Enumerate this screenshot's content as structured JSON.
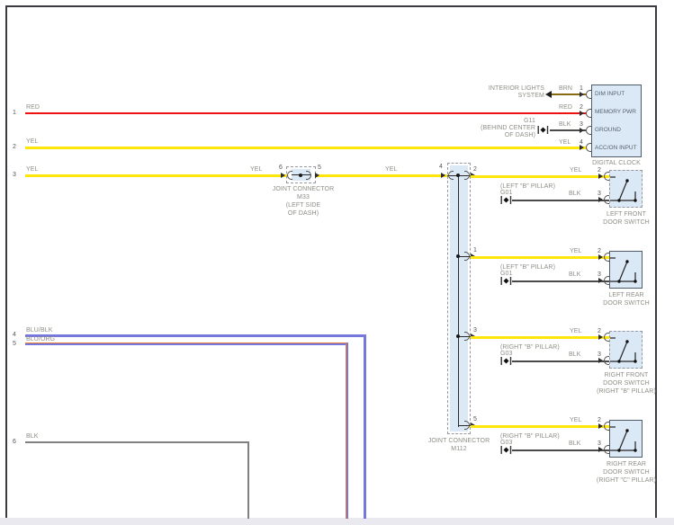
{
  "left_wires": [
    {
      "num": "1",
      "label": "RED"
    },
    {
      "num": "2",
      "label": "YEL"
    },
    {
      "num": "3",
      "label": "YEL"
    },
    {
      "num": "4",
      "label": "BLU/BLK"
    },
    {
      "num": "5",
      "label": "BLU/ORG"
    },
    {
      "num": "6",
      "label": "BLK"
    }
  ],
  "interior_lights": {
    "line1": "INTERIOR LIGHTS",
    "line2": "SYSTEM"
  },
  "clock": {
    "title": "DIGITAL CLOCK",
    "pins": [
      {
        "num": "1",
        "wire": "BRN",
        "label": "DIM INPUT"
      },
      {
        "num": "2",
        "wire": "RED",
        "label": "MEMORY PWR"
      },
      {
        "num": "3",
        "wire": "BLK",
        "label": "GROUND"
      },
      {
        "num": "4",
        "wire": "YEL",
        "label": "ACC/ON INPUT"
      }
    ]
  },
  "g11": {
    "id": "G11",
    "loc1": "(BEHIND CENTER",
    "loc2": "OF DASH)"
  },
  "m33": {
    "pin_left": "6",
    "pin_right": "5",
    "wire_mid": "YEL",
    "wire_after": "YEL",
    "name1": "JOINT CONNECTOR",
    "name2": "M33",
    "name3": "(LEFT SIDE",
    "name4": "OF DASH)"
  },
  "m112": {
    "pin_in": "4",
    "name1": "JOINT CONNECTOR",
    "name2": "M112"
  },
  "switches": [
    {
      "wire_top": "YEL",
      "pin_top": "2",
      "m112_pin": "2",
      "wire_bottom": "BLK",
      "pin_bottom": "3",
      "ground_loc": "(LEFT \"B\" PILLAR)",
      "ground_id": "G01",
      "name1": "LEFT FRONT",
      "name2": "DOOR SWITCH",
      "name3": ""
    },
    {
      "wire_top": "YEL",
      "pin_top": "2",
      "m112_pin": "1",
      "wire_bottom": "BLK",
      "pin_bottom": "3",
      "ground_loc": "(LEFT \"B\" PILLAR)",
      "ground_id": "G01",
      "name1": "LEFT REAR",
      "name2": "DOOR SWITCH",
      "name3": ""
    },
    {
      "wire_top": "YEL",
      "pin_top": "2",
      "m112_pin": "3",
      "wire_bottom": "BLK",
      "pin_bottom": "3",
      "ground_loc": "(RIGHT \"B\" PILLAR)",
      "ground_id": "G03",
      "name1": "RIGHT FRONT",
      "name2": "DOOR SWITCH",
      "name3": "(RIGHT \"B\" PILLAR)"
    },
    {
      "wire_top": "YEL",
      "pin_top": "2",
      "m112_pin": "5",
      "wire_bottom": "BLK",
      "pin_bottom": "3",
      "ground_loc": "(RIGHT \"B\" PILLAR)",
      "ground_id": "G03",
      "name1": "RIGHT REAR",
      "name2": "DOOR SWITCH",
      "name3": "(RIGHT \"C\" PILLAR)"
    }
  ],
  "colors": {
    "red": "#ee1111",
    "yellow": "#ffe60a",
    "brown": "#8a6a10",
    "blue": "#7678de",
    "orange": "#e87f35",
    "black_wire": "#4a4a4a",
    "gray_wire": "#808080",
    "box_fill": "#dbe9f7",
    "frame": "#3a3a40"
  }
}
